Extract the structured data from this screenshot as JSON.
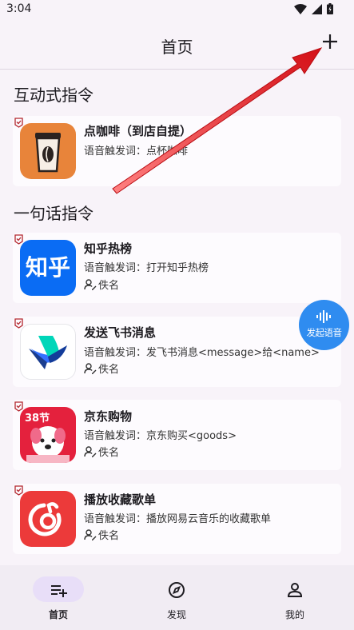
{
  "status_bar": {
    "time": "3:04"
  },
  "header": {
    "title": "首页",
    "add_label": "+"
  },
  "sections": {
    "interactive": "互动式指令",
    "one_sentence": "一句话指令"
  },
  "interactive_commands": [
    {
      "title": "点咖啡（到店自提）",
      "trigger": "语音触发词：点杯咖啡",
      "icon": "coffee-icon"
    }
  ],
  "one_sentence_commands": [
    {
      "title": "知乎热榜",
      "trigger": "语音触发词：打开知乎热榜",
      "author": "佚名",
      "icon": "zhihu-icon",
      "icon_text": "知乎"
    },
    {
      "title": "发送飞书消息",
      "trigger": "语音触发词：发飞书消息<message>给<name>",
      "author": "佚名",
      "icon": "feishu-icon"
    },
    {
      "title": "京东购物",
      "trigger": "语音触发词：京东购买<goods>",
      "author": "佚名",
      "icon": "jd-icon",
      "icon_badge": "38节"
    },
    {
      "title": "播放收藏歌单",
      "trigger": "语音触发词：播放网易云音乐的收藏歌单",
      "author": "佚名",
      "icon": "netease-music-icon"
    }
  ],
  "voice_fab": {
    "label": "发起语音"
  },
  "bottom_nav": [
    {
      "label": "首页",
      "icon": "list-add-icon",
      "active": true
    },
    {
      "label": "发现",
      "icon": "compass-icon",
      "active": false
    },
    {
      "label": "我的",
      "icon": "person-icon",
      "active": false
    }
  ],
  "colors": {
    "background": "#f8f3f9",
    "card": "#fdfbfe",
    "accent": "#2f8cf0",
    "nav_active": "#e8def8",
    "flag": "#b3262e",
    "annotation_arrow": "#e0141b"
  }
}
